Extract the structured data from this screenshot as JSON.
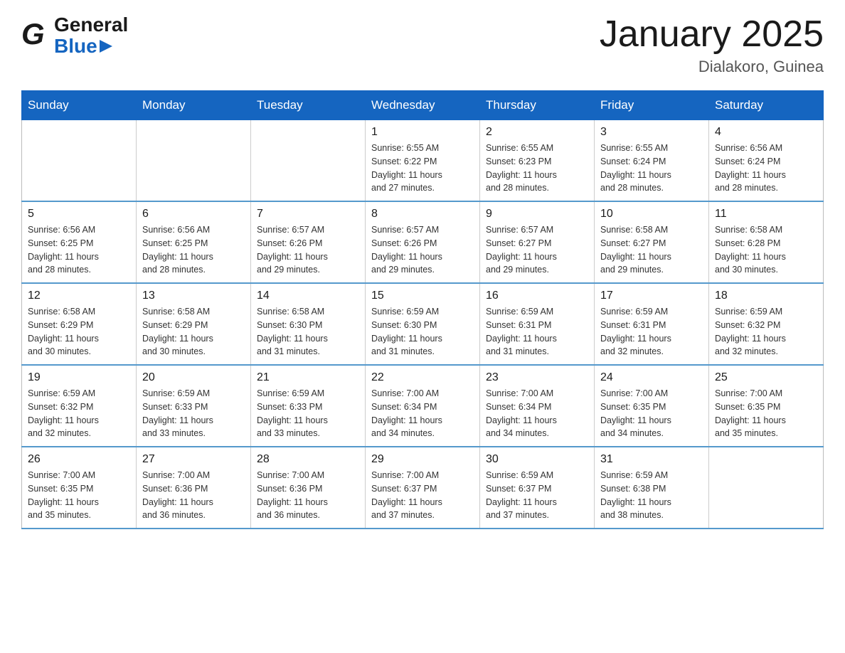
{
  "logo": {
    "general": "General",
    "blue": "Blue",
    "arrow": "▶"
  },
  "title": "January 2025",
  "subtitle": "Dialakoro, Guinea",
  "calendar": {
    "headers": [
      "Sunday",
      "Monday",
      "Tuesday",
      "Wednesday",
      "Thursday",
      "Friday",
      "Saturday"
    ],
    "weeks": [
      {
        "days": [
          {
            "number": "",
            "info": ""
          },
          {
            "number": "",
            "info": ""
          },
          {
            "number": "",
            "info": ""
          },
          {
            "number": "1",
            "info": "Sunrise: 6:55 AM\nSunset: 6:22 PM\nDaylight: 11 hours\nand 27 minutes."
          },
          {
            "number": "2",
            "info": "Sunrise: 6:55 AM\nSunset: 6:23 PM\nDaylight: 11 hours\nand 28 minutes."
          },
          {
            "number": "3",
            "info": "Sunrise: 6:55 AM\nSunset: 6:24 PM\nDaylight: 11 hours\nand 28 minutes."
          },
          {
            "number": "4",
            "info": "Sunrise: 6:56 AM\nSunset: 6:24 PM\nDaylight: 11 hours\nand 28 minutes."
          }
        ]
      },
      {
        "days": [
          {
            "number": "5",
            "info": "Sunrise: 6:56 AM\nSunset: 6:25 PM\nDaylight: 11 hours\nand 28 minutes."
          },
          {
            "number": "6",
            "info": "Sunrise: 6:56 AM\nSunset: 6:25 PM\nDaylight: 11 hours\nand 28 minutes."
          },
          {
            "number": "7",
            "info": "Sunrise: 6:57 AM\nSunset: 6:26 PM\nDaylight: 11 hours\nand 29 minutes."
          },
          {
            "number": "8",
            "info": "Sunrise: 6:57 AM\nSunset: 6:26 PM\nDaylight: 11 hours\nand 29 minutes."
          },
          {
            "number": "9",
            "info": "Sunrise: 6:57 AM\nSunset: 6:27 PM\nDaylight: 11 hours\nand 29 minutes."
          },
          {
            "number": "10",
            "info": "Sunrise: 6:58 AM\nSunset: 6:27 PM\nDaylight: 11 hours\nand 29 minutes."
          },
          {
            "number": "11",
            "info": "Sunrise: 6:58 AM\nSunset: 6:28 PM\nDaylight: 11 hours\nand 30 minutes."
          }
        ]
      },
      {
        "days": [
          {
            "number": "12",
            "info": "Sunrise: 6:58 AM\nSunset: 6:29 PM\nDaylight: 11 hours\nand 30 minutes."
          },
          {
            "number": "13",
            "info": "Sunrise: 6:58 AM\nSunset: 6:29 PM\nDaylight: 11 hours\nand 30 minutes."
          },
          {
            "number": "14",
            "info": "Sunrise: 6:58 AM\nSunset: 6:30 PM\nDaylight: 11 hours\nand 31 minutes."
          },
          {
            "number": "15",
            "info": "Sunrise: 6:59 AM\nSunset: 6:30 PM\nDaylight: 11 hours\nand 31 minutes."
          },
          {
            "number": "16",
            "info": "Sunrise: 6:59 AM\nSunset: 6:31 PM\nDaylight: 11 hours\nand 31 minutes."
          },
          {
            "number": "17",
            "info": "Sunrise: 6:59 AM\nSunset: 6:31 PM\nDaylight: 11 hours\nand 32 minutes."
          },
          {
            "number": "18",
            "info": "Sunrise: 6:59 AM\nSunset: 6:32 PM\nDaylight: 11 hours\nand 32 minutes."
          }
        ]
      },
      {
        "days": [
          {
            "number": "19",
            "info": "Sunrise: 6:59 AM\nSunset: 6:32 PM\nDaylight: 11 hours\nand 32 minutes."
          },
          {
            "number": "20",
            "info": "Sunrise: 6:59 AM\nSunset: 6:33 PM\nDaylight: 11 hours\nand 33 minutes."
          },
          {
            "number": "21",
            "info": "Sunrise: 6:59 AM\nSunset: 6:33 PM\nDaylight: 11 hours\nand 33 minutes."
          },
          {
            "number": "22",
            "info": "Sunrise: 7:00 AM\nSunset: 6:34 PM\nDaylight: 11 hours\nand 34 minutes."
          },
          {
            "number": "23",
            "info": "Sunrise: 7:00 AM\nSunset: 6:34 PM\nDaylight: 11 hours\nand 34 minutes."
          },
          {
            "number": "24",
            "info": "Sunrise: 7:00 AM\nSunset: 6:35 PM\nDaylight: 11 hours\nand 34 minutes."
          },
          {
            "number": "25",
            "info": "Sunrise: 7:00 AM\nSunset: 6:35 PM\nDaylight: 11 hours\nand 35 minutes."
          }
        ]
      },
      {
        "days": [
          {
            "number": "26",
            "info": "Sunrise: 7:00 AM\nSunset: 6:35 PM\nDaylight: 11 hours\nand 35 minutes."
          },
          {
            "number": "27",
            "info": "Sunrise: 7:00 AM\nSunset: 6:36 PM\nDaylight: 11 hours\nand 36 minutes."
          },
          {
            "number": "28",
            "info": "Sunrise: 7:00 AM\nSunset: 6:36 PM\nDaylight: 11 hours\nand 36 minutes."
          },
          {
            "number": "29",
            "info": "Sunrise: 7:00 AM\nSunset: 6:37 PM\nDaylight: 11 hours\nand 37 minutes."
          },
          {
            "number": "30",
            "info": "Sunrise: 6:59 AM\nSunset: 6:37 PM\nDaylight: 11 hours\nand 37 minutes."
          },
          {
            "number": "31",
            "info": "Sunrise: 6:59 AM\nSunset: 6:38 PM\nDaylight: 11 hours\nand 38 minutes."
          },
          {
            "number": "",
            "info": ""
          }
        ]
      }
    ]
  }
}
